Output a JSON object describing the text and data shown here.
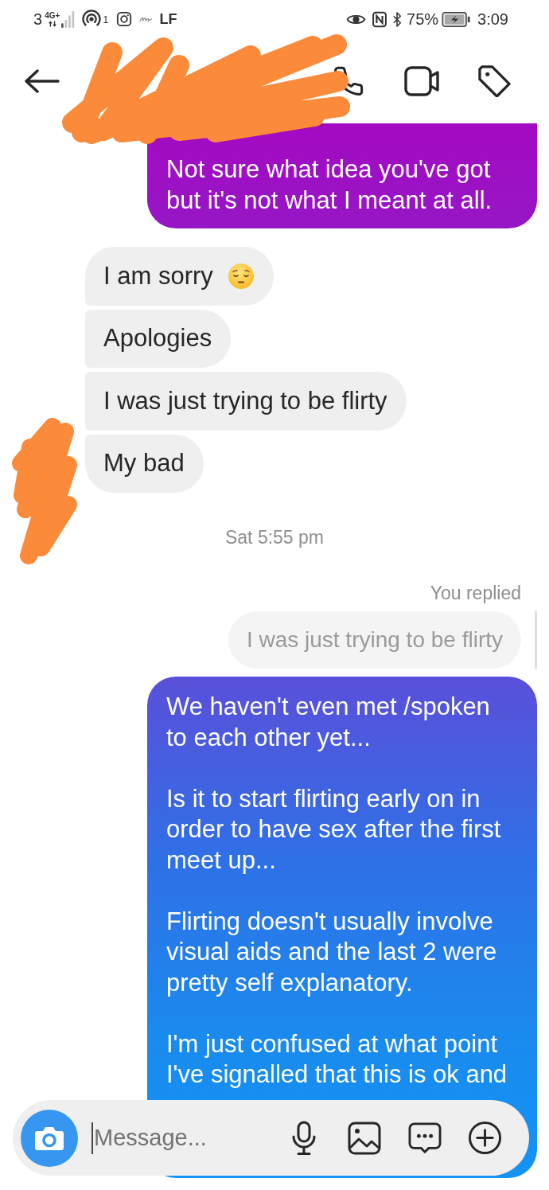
{
  "status_bar": {
    "sim": "3",
    "network": "4G+",
    "hotspot_count": "1",
    "label": "LF",
    "battery": "75%",
    "time": "3:09"
  },
  "thread": [
    {
      "kind": "outgoing",
      "paragraphs": [
        "Not sure what idea you've got but it's not what I meant at all."
      ]
    },
    {
      "kind": "incoming_group",
      "messages": [
        {
          "text": "I am sorry",
          "with_emoji": true
        },
        {
          "text": "Apologies",
          "with_emoji": false
        },
        {
          "text": "I was just trying to be flirty",
          "with_emoji": false
        },
        {
          "text": "My bad",
          "with_emoji": false
        }
      ]
    },
    {
      "kind": "timestamp",
      "text": "Sat 5:55 pm"
    },
    {
      "kind": "reply",
      "label": "You replied",
      "quote": "I was just trying to be flirty"
    },
    {
      "kind": "outgoing",
      "paragraphs": [
        "We haven't even met /spoken to each other yet...",
        "Is it to start flirting early on in order to have sex after the first meet up...",
        "Flirting doesn't usually involve visual aids and the last 2 were pretty self explanatory.",
        "I'm just confused at what point I've signalled that this is ok and"
      ]
    }
  ],
  "composer": {
    "placeholder": "Message..."
  }
}
